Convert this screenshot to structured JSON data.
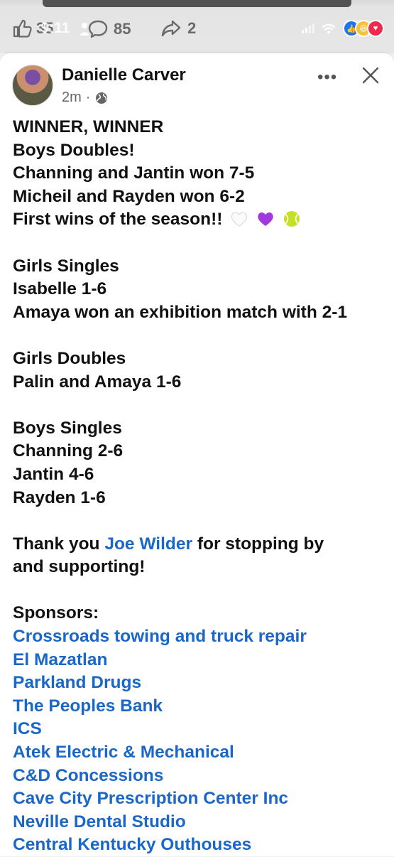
{
  "reactions_bar": {
    "likes": "35",
    "time_overlay": "9:11",
    "comments": "85",
    "shares": "2"
  },
  "post": {
    "author": "Danielle Carver",
    "time": "2m",
    "lines": {
      "l1": "WINNER, WINNER",
      "l2": "Boys Doubles!",
      "l3": "Channing and Jantin won 7-5",
      "l4": "Micheil and Rayden won 6-2",
      "l5": "First wins of the season!!",
      "l6": "Girls Singles",
      "l7": "Isabelle 1-6",
      "l8": "Amaya won an exhibition match with 2-1",
      "l9": "Girls Doubles",
      "l10": "Palin and Amaya 1-6",
      "l11": "Boys Singles",
      "l12": "Channing 2-6",
      "l13": "Jantin 4-6",
      "l14": "Rayden 1-6",
      "thanks_pre": "Thank you",
      "thanks_link": "Joe Wilder",
      "thanks_post": "for stopping by",
      "thanks_line2": "and supporting!",
      "sponsors_heading": "Sponsors:"
    },
    "sponsors": [
      "Crossroads towing and truck repair",
      "El Mazatlan",
      "Parkland Drugs",
      "The Peoples Bank",
      "ICS",
      "Atek Electric & Mechanical",
      "C&D Concessions",
      "Cave City Prescription Center Inc",
      "Neville Dental Studio",
      "Central Kentucky Outhouses"
    ],
    "emojis": [
      "white-heart-icon",
      "purple-heart-icon",
      "tennis-ball-icon"
    ]
  },
  "colors": {
    "link": "#1b67c7",
    "text": "#111111"
  }
}
